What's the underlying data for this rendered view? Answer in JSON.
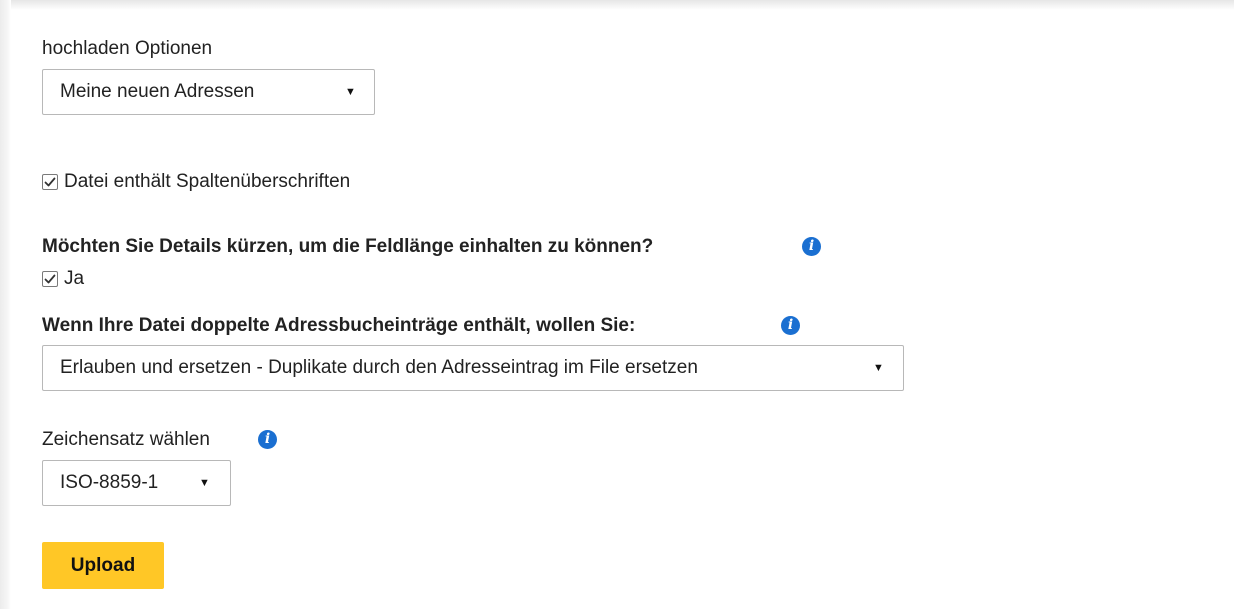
{
  "upload_options": {
    "label": "hochladen Optionen",
    "selected": "Meine neuen Adressen"
  },
  "header_row": {
    "label": "Datei enthält Spaltenüberschriften",
    "checked": true
  },
  "truncate": {
    "question": "Möchten Sie Details kürzen, um die Feldlänge einhalten zu können?",
    "option_label": "Ja",
    "checked": true
  },
  "duplicates": {
    "question": "Wenn Ihre Datei doppelte Adressbucheinträge enthält, wollen Sie:",
    "selected": "Erlauben und ersetzen - Duplikate durch den Adresseintrag im File ersetzen"
  },
  "charset": {
    "label": "Zeichensatz wählen",
    "selected": "ISO-8859-1"
  },
  "upload_button": {
    "label": "Upload"
  },
  "icons": {
    "info": "info-circle-icon",
    "caret": "caret-down-icon",
    "checkmark": "check-icon"
  },
  "colors": {
    "info_blue": "#1a6fd1",
    "button_yellow": "#ffc726",
    "border_gray": "#b8b8b8"
  }
}
